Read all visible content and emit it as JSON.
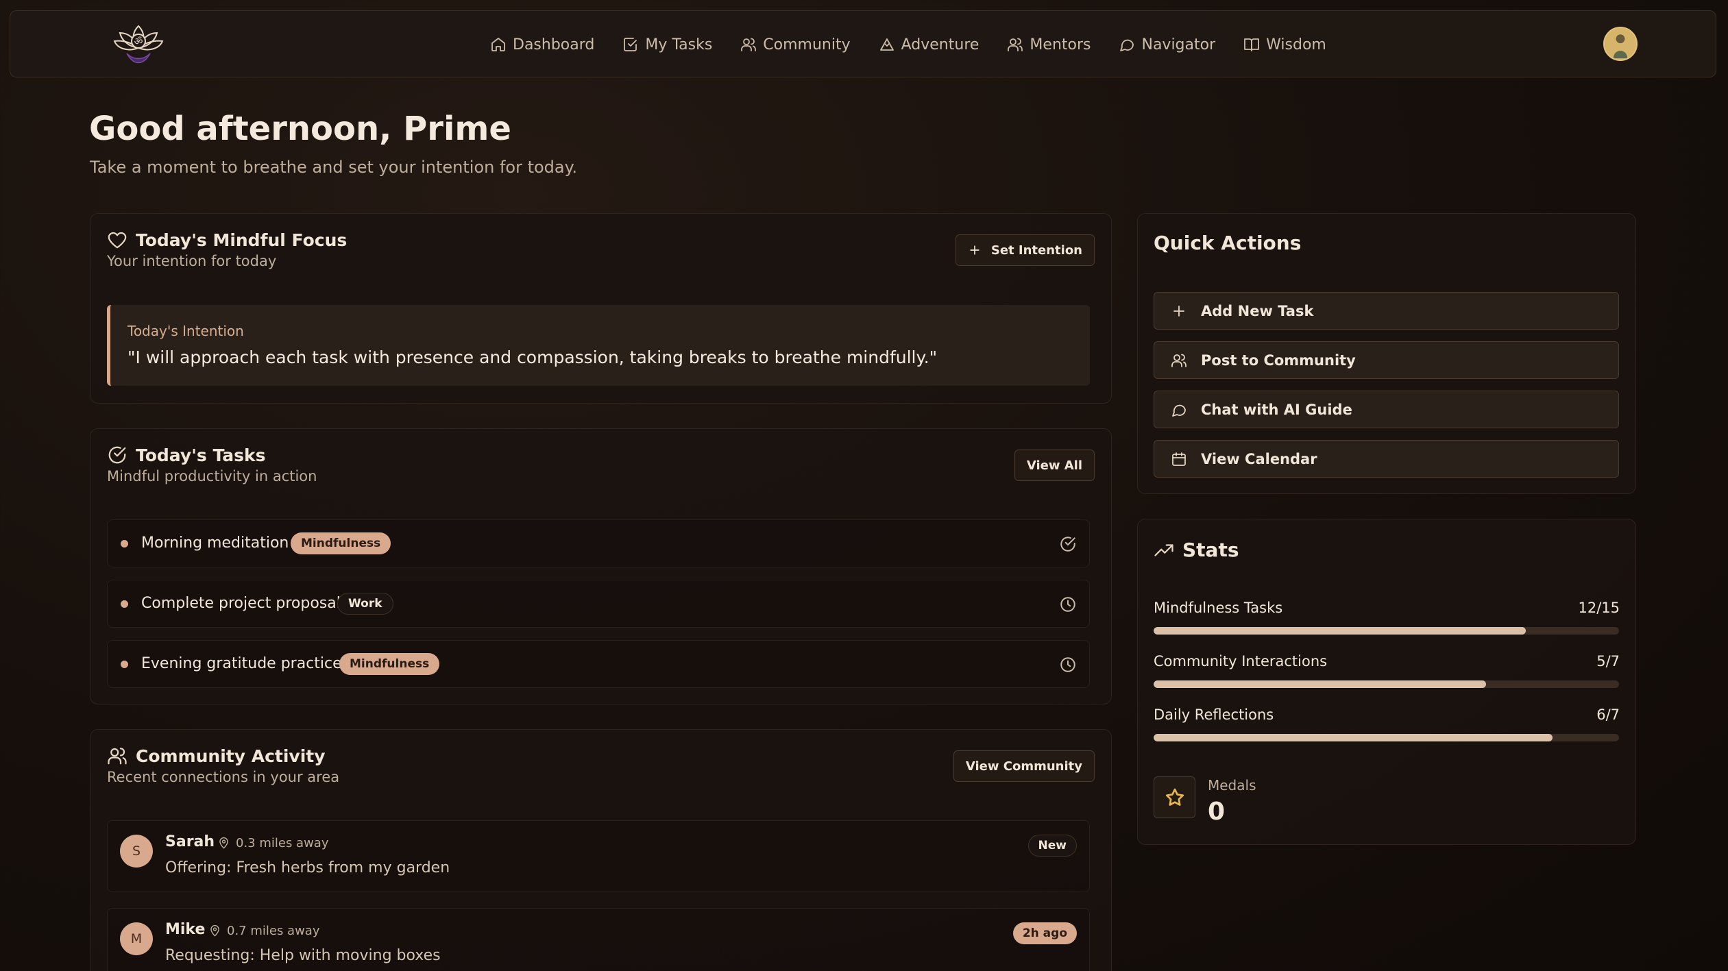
{
  "nav": {
    "items": [
      {
        "label": "Dashboard",
        "icon": "home-icon"
      },
      {
        "label": "My Tasks",
        "icon": "check-square-icon"
      },
      {
        "label": "Community",
        "icon": "users-icon"
      },
      {
        "label": "Adventure",
        "icon": "mountain-icon"
      },
      {
        "label": "Mentors",
        "icon": "user-group-icon"
      },
      {
        "label": "Navigator",
        "icon": "message-circle-icon"
      },
      {
        "label": "Wisdom",
        "icon": "book-open-icon"
      }
    ]
  },
  "header": {
    "greeting": "Good afternoon, Prime",
    "subtitle": "Take a moment to breathe and set your intention for today."
  },
  "focus": {
    "title": "Today's Mindful Focus",
    "subtitle": "Your intention for today",
    "button": "Set Intention",
    "intention_label": "Today's Intention",
    "intention_text": "\"I will approach each task with presence and compassion, taking breaks to breathe mindfully.\""
  },
  "tasks": {
    "title": "Today's Tasks",
    "subtitle": "Mindful productivity in action",
    "button": "View All",
    "items": [
      {
        "name": "Morning meditation",
        "tag": "Mindfulness",
        "status": "check-circle-icon"
      },
      {
        "name": "Complete project proposal",
        "tag": "Work",
        "status": "clock-icon"
      },
      {
        "name": "Evening gratitude practice",
        "tag": "Mindfulness",
        "status": "clock-icon"
      }
    ]
  },
  "community": {
    "title": "Community Activity",
    "subtitle": "Recent connections in your area",
    "button": "View Community",
    "items": [
      {
        "initial": "S",
        "name": "Sarah",
        "distance": "0.3 miles away",
        "message": "Offering: Fresh herbs from my garden",
        "badge": "New"
      },
      {
        "initial": "M",
        "name": "Mike",
        "distance": "0.7 miles away",
        "message": "Requesting: Help with moving boxes",
        "badge": "2h ago"
      }
    ]
  },
  "quick_actions": {
    "title": "Quick Actions",
    "items": [
      {
        "label": "Add New Task",
        "icon": "plus-icon"
      },
      {
        "label": "Post to Community",
        "icon": "users-icon"
      },
      {
        "label": "Chat with AI Guide",
        "icon": "message-circle-icon"
      },
      {
        "label": "View Calendar",
        "icon": "calendar-icon"
      }
    ]
  },
  "stats": {
    "title": "Stats",
    "items": [
      {
        "label": "Mindfulness Tasks",
        "value": "12/15",
        "progress": 0.8
      },
      {
        "label": "Community Interactions",
        "value": "5/7",
        "progress": 0.714
      },
      {
        "label": "Daily Reflections",
        "value": "6/7",
        "progress": 0.857
      }
    ],
    "medals_label": "Medals",
    "medals_value": "0"
  },
  "colors": {
    "accent": "#d9a98e",
    "background": "#160f0b",
    "progress_fill": "#dcc0a8",
    "medal_star": "#e8b84a"
  }
}
